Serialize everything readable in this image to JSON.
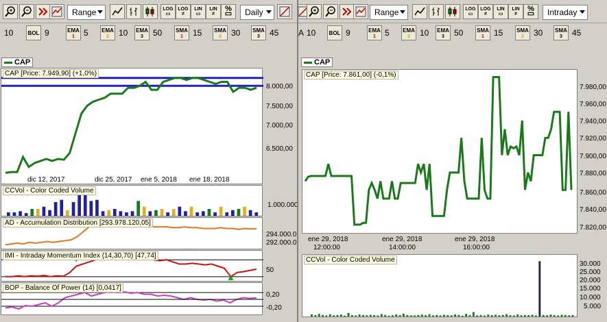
{
  "left": {
    "toolbar": {
      "range_label": "Range",
      "period_label": "Daily",
      "log_label": "LOG",
      "log2_label": "LOG",
      "lin_label": "LIN",
      "lin2_label": "LIN",
      "pct_label": "%"
    },
    "indicators": {
      "first_value": "10",
      "bol_label": "BOL",
      "bol_value": "9",
      "ema1_label": "EMA",
      "ema1_sub": "1",
      "ema1_value": "5",
      "ema2_label": "EMA",
      "ema2_sub": "2",
      "ema2_value": "10",
      "ema3_label": "EMA",
      "ema3_sub": "3",
      "ema3_value": "50",
      "sma1_label": "SMA",
      "sma1_sub": "1",
      "sma1_value": "15",
      "sma2_label": "SMA",
      "sma2_sub": "2",
      "sma2_value": "30",
      "sma3_label": "SMA",
      "sma3_sub": "3",
      "sma3_value": "45"
    },
    "series_tag": "CAP",
    "price_panel": {
      "title": "CAP [Price: 7.949,90] (+1,0%)",
      "y_ticks": [
        "8.000,00",
        "7.500,00",
        "7.000,00",
        "6.500,00"
      ],
      "x_ticks": [
        "dic 12, 2017",
        "dic 25, 2017",
        "ene 5, 2018",
        "ene 18, 2018"
      ]
    },
    "ccvol_panel": {
      "title": "CCVol - Color Coded Volume",
      "y_tick": "1.000.000"
    },
    "ad_panel": {
      "title": "AD - Accumulation Distribution [293.978.120,05]",
      "y_ticks": [
        "294.000.0",
        "292.000.0"
      ]
    },
    "imi_panel": {
      "title": "IMI - Intraday Momentum Index (14,30,70) [47,74]",
      "y_tick": "50"
    },
    "bop_panel": {
      "title": "BOP - Balance Of Power (14) [0,0417]",
      "y_ticks": [
        "0,20",
        "-0,20"
      ]
    }
  },
  "right": {
    "toolbar": {
      "range_label": "Range",
      "period_label": "Intraday",
      "log_label": "LOG",
      "log2_label": "LOG",
      "lin_label": "LIN",
      "lin2_label": "LIN",
      "pct_label": "%"
    },
    "indicators": {
      "first_label": "A",
      "first_value": "10",
      "bol_label": "BOL",
      "bol_value": "9",
      "ema1_label": "EMA",
      "ema1_sub": "1",
      "ema1_value": "5",
      "ema2_label": "EMA",
      "ema2_sub": "2",
      "ema2_value": "10",
      "ema3_label": "EMA",
      "ema3_sub": "3",
      "ema3_value": "50",
      "sma1_label": "SMA",
      "sma1_sub": "1",
      "sma1_value": "15",
      "sma2_label": "SMA",
      "sma2_sub": "2",
      "sma2_value": "30",
      "sma3_label": "SMA",
      "sma3_sub": "3",
      "sma3_value": "45"
    },
    "series_tag": "CAP",
    "price_panel": {
      "title": "CAP [Price: 7.861,00] (-0,1%)",
      "y_ticks": [
        "7.980,00",
        "7.960,00",
        "7.940,00",
        "7.920,00",
        "7.900,00",
        "7.880,00",
        "7.860,00",
        "7.840,00",
        "7.820,00"
      ],
      "x_ticks_date": [
        "ene 29, 2018",
        "ene 29, 2018",
        "ene 29, 2018"
      ],
      "x_ticks_time": [
        "12:00:00",
        "14:00:00",
        "16:00:00"
      ]
    },
    "ccvol_panel": {
      "title": "CCVol - Color Coded Volume",
      "y_ticks": [
        "30.000",
        "25.000",
        "20.000",
        "15.000",
        "10.000",
        "5.000"
      ]
    }
  },
  "colors": {
    "price_line": "#1a7a1a",
    "ref_line": "#2020c0",
    "ad_line": "#e07820",
    "imi_line": "#d01010",
    "bop_line": "#c040c0"
  },
  "chart_data": [
    {
      "type": "line",
      "title": "CAP [Price: 7.949,90] (+1,0%)",
      "x": [
        "dic 12, 2017",
        "dic 25, 2017",
        "ene 5, 2018",
        "ene 18, 2018"
      ],
      "series": [
        {
          "name": "CAP",
          "values": [
            5800,
            5820,
            5820,
            6200,
            5950,
            6050,
            6100,
            6150,
            6100,
            6150,
            6130,
            6300,
            6800,
            7300,
            7500,
            7600,
            7650,
            7700,
            7800,
            7800,
            7800,
            7950,
            7950,
            8000,
            8100,
            7900,
            7900,
            8100,
            8150,
            8200,
            8200,
            8150,
            8200,
            8200,
            8150,
            8100,
            8050,
            8100,
            8100,
            7850,
            7950,
            7950,
            7900,
            7950
          ]
        }
      ],
      "ref_lines": [
        8200,
        8000
      ],
      "ylim": [
        5700,
        8300
      ],
      "y_ticks": [
        8000,
        7500,
        7000,
        6500
      ]
    },
    {
      "type": "line",
      "title": "CAP [Price: 7.861,00] (-0,1%)",
      "x": [
        "12:00:00",
        "14:00:00",
        "16:00:00"
      ],
      "series": [
        {
          "name": "CAP",
          "values": [
            7870,
            7875,
            7876,
            7876,
            7876,
            7876,
            7876,
            7876,
            7890,
            7876,
            7876,
            7876,
            7876,
            7876,
            7876,
            7876,
            7876,
            7820,
            7820,
            7820,
            7822,
            7822,
            7860,
            7868,
            7860,
            7850,
            7870,
            7850,
            7850,
            7850,
            7870,
            7850,
            7850,
            7868,
            7868,
            7868,
            7868,
            7868,
            7868,
            7890,
            7880,
            7890,
            7860,
            7890,
            7830,
            7830,
            7830,
            7830,
            7830,
            7860,
            7880,
            7880,
            7880,
            7880,
            7920,
            7870,
            7850,
            7850,
            7850,
            7850,
            7850,
            7920,
            7860,
            7850,
            7850,
            7990,
            7990,
            7990,
            7900,
            7930,
            7900,
            7910,
            7908,
            7910,
            7900,
            7940,
            7860,
            7880,
            7870,
            7900,
            7900,
            7900,
            7900,
            7920,
            7920,
            7930,
            7950,
            7950,
            7950,
            7860,
            7860,
            7950,
            7860
          ]
        }
      ],
      "ylim": [
        7812,
        7992
      ],
      "y_ticks": [
        7980,
        7960,
        7940,
        7920,
        7900,
        7880,
        7860,
        7840,
        7820
      ]
    },
    {
      "type": "bar",
      "title": "CCVol - Color Coded Volume",
      "series": [
        {
          "name": "CCVol",
          "values": [
            150000,
            150000,
            200000,
            120000,
            300000,
            300000,
            400000,
            250000,
            600000,
            700000,
            250000,
            600000,
            1050000,
            900000,
            650000,
            700000,
            200000,
            250000,
            300000,
            200000,
            150000,
            200000,
            650000,
            400000,
            200000,
            250000,
            300000,
            150000,
            300000,
            400000,
            200000,
            400000,
            150000,
            200000,
            300000,
            150000,
            400000,
            150000,
            250000,
            300000,
            400000,
            250000,
            150000
          ]
        }
      ],
      "bar_colors": [
        "#2020a0",
        "#2020a0",
        "#2020a0",
        "#2020a0",
        "#1a7a1a",
        "#e0b020",
        "#2020a0",
        "#2020a0",
        "#2020a0",
        "#2020a0",
        "#e0b020",
        "#2020a0",
        "#2020a0",
        "#2020a0",
        "#2020a0",
        "#2020a0",
        "#2020a0",
        "#e0b020",
        "#2020a0",
        "#2020a0",
        "#2020a0",
        "#2020a0",
        "#1a7a1a",
        "#e0b020",
        "#2020a0",
        "#1a7a1a",
        "#e0b020",
        "#2020a0",
        "#e0b020",
        "#2020a0",
        "#2020a0",
        "#e0b020",
        "#2020a0",
        "#2020a0",
        "#1a7a1a",
        "#2020a0",
        "#e0b020",
        "#2020a0",
        "#2020a0",
        "#1a7a1a",
        "#e0b020",
        "#2020a0",
        "#2020a0"
      ],
      "ylim": [
        0,
        1200000
      ],
      "y_ticks": [
        1000000
      ]
    },
    {
      "type": "line",
      "title": "AD - Accumulation Distribution [293.978.120,05]",
      "series": [
        {
          "name": "AD",
          "values": [
            292000000,
            292100000,
            292200000,
            292100000,
            292300000,
            292200000,
            292300000,
            292400000,
            292300000,
            292400000,
            292500000,
            292600000,
            293000000,
            293600000,
            294200000,
            294300000,
            294300000,
            294300000,
            294400000,
            294300000,
            294300000,
            294300000,
            294300000,
            294200000,
            294300000,
            294200000,
            294200000,
            294200000,
            294100000,
            294100000,
            294200000,
            294100000,
            294100000,
            294000000,
            294000000,
            294000000,
            294100000,
            294000000,
            294000000,
            293900000,
            294000000,
            293950000,
            293978120
          ]
        }
      ],
      "ylim": [
        291600000,
        294800000
      ],
      "y_ticks": [
        294000000,
        292000000
      ]
    },
    {
      "type": "line",
      "title": "IMI - Intraday Momentum Index (14,30,70) [47,74]",
      "series": [
        {
          "name": "IMI",
          "values": [
            30,
            30,
            32,
            30,
            32,
            31,
            33,
            30,
            32,
            31,
            40,
            55,
            60,
            65,
            70,
            75,
            72,
            75,
            78,
            78,
            75,
            70,
            72,
            70,
            68,
            70,
            65,
            60,
            60,
            62,
            60,
            58,
            60,
            55,
            50,
            30,
            40,
            42,
            45,
            47.74
          ]
        }
      ],
      "ref_lines": [
        70,
        30
      ],
      "ylim": [
        20,
        85
      ],
      "y_ticks": [
        50
      ]
    },
    {
      "type": "line",
      "title": "BOP - Balance Of Power (14) [0,0417]",
      "series": [
        {
          "name": "BOP",
          "values": [
            -0.25,
            -0.22,
            -0.28,
            -0.18,
            -0.2,
            -0.15,
            -0.1,
            -0.2,
            -0.1,
            0.05,
            0.1,
            0.15,
            0.2,
            0.1,
            0.15,
            0.2,
            0.22,
            0.2,
            0.22,
            0.18,
            0.2,
            0.15,
            0.15,
            0.1,
            0.12,
            0.1,
            0.05,
            0.0,
            0.05,
            0.0,
            -0.02,
            0.0,
            -0.05,
            -0.02,
            -0.1,
            0.0,
            0.05,
            0.03,
            0.0417
          ]
        }
      ],
      "ref_lines": [
        0.2,
        -0.2
      ],
      "ylim": [
        -0.4,
        0.4
      ],
      "y_ticks": [
        0.2,
        -0.2
      ]
    },
    {
      "type": "bar",
      "title": "CCVol - Color Coded Volume",
      "series": [
        {
          "name": "CCVol",
          "values": [
            1200,
            800,
            1500,
            900,
            600,
            1300,
            700,
            900,
            1100,
            500,
            2000,
            800,
            600,
            1200,
            900,
            700,
            1000,
            800,
            600,
            1400,
            900,
            500,
            700,
            1200,
            800,
            1600,
            900,
            700,
            600,
            900,
            1100,
            800,
            1300,
            700,
            900,
            600,
            1000,
            800,
            700,
            1200,
            900,
            500,
            1500,
            800,
            2500,
            700,
            900,
            600,
            1100,
            800,
            1000,
            700,
            900,
            1300,
            800,
            600,
            1200,
            700,
            900,
            800,
            1000,
            600,
            31000,
            900,
            700,
            1100,
            800,
            600,
            1000,
            900,
            700,
            800
          ]
        }
      ],
      "ylim": [
        0,
        33000
      ],
      "y_ticks": [
        30000,
        25000,
        20000,
        15000,
        10000,
        5000
      ]
    }
  ]
}
